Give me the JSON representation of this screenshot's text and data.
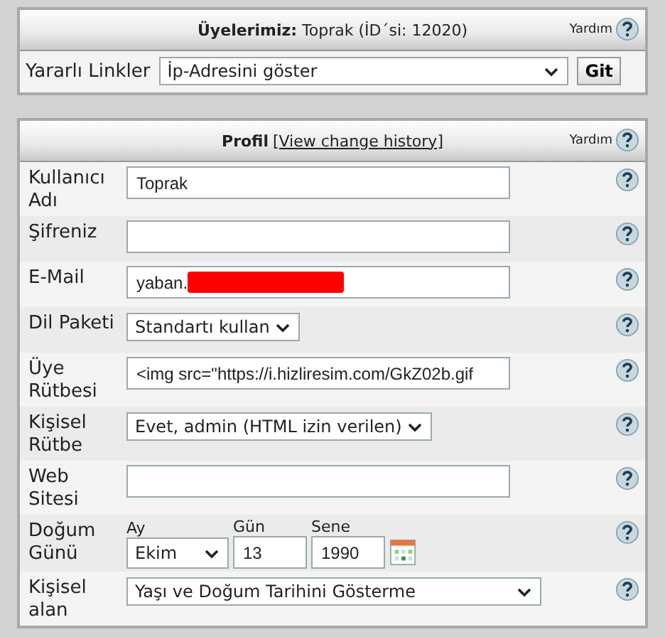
{
  "member_panel": {
    "title": "**Üyelerimiz:** Toprak (İD´si: 12020)",
    "help": "Yardım",
    "links_label": "Yararlı Linkler",
    "links_select": "İp-Adresini göster",
    "go_button": "Git"
  },
  "profile_panel": {
    "title": "Profil",
    "history_link": "[View change history]",
    "help": "Yardım",
    "rows": [
      {
        "kind": "text",
        "label": "Kullanıcı Adı",
        "value": "Toprak"
      },
      {
        "kind": "text",
        "label": "Şifreniz"
      },
      {
        "kind": "text",
        "label": "E-Mail",
        "value": "yaban.",
        "redacted": true
      },
      {
        "kind": "select",
        "label": "Dil Paketi",
        "value": "Standartı kullan"
      },
      {
        "kind": "text",
        "label": "Üye Rütbesi",
        "value": "<img src=\"https://i.hizliresim.com/GkZ02b.gif"
      },
      {
        "kind": "select",
        "label": "Kişisel Rütbe",
        "value": "Evet, admin (HTML izin verilen)"
      },
      {
        "kind": "text",
        "label": "Web Sitesi"
      },
      {
        "kind": "date",
        "label": "Doğum Günü",
        "month_label": "Ay",
        "month": "Ekim",
        "day_label": "Gün",
        "day": "13",
        "year_label": "Sene",
        "year": "1990"
      },
      {
        "kind": "wide_select",
        "label": "Kişisel alan",
        "value": "Yaşı ve Doğum Tarihini Gösterme"
      }
    ]
  }
}
